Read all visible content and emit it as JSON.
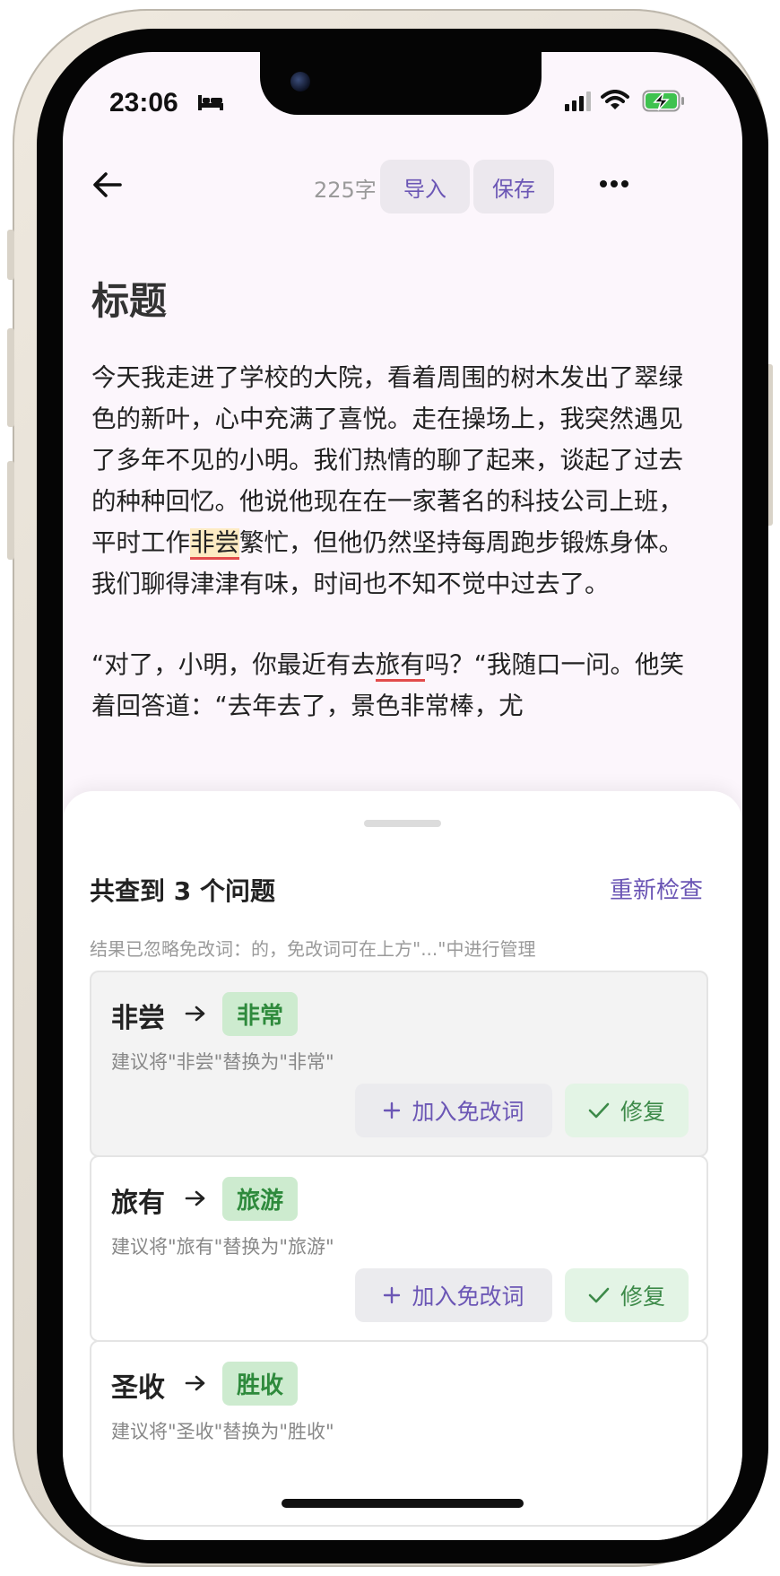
{
  "status_bar": {
    "time": "23:06"
  },
  "toolbar": {
    "word_count": "225字",
    "import_label": "导入",
    "save_label": "保存"
  },
  "document": {
    "title": "标题",
    "p1_before": "今天我走进了学校的大院，看着周围的树木发出了翠绿色的新叶，心中充满了喜悦。走在操场上，我突然遇见了多年不见的小明。我们热情的聊了起来，谈起了过去的种种回忆。他说他现在在一家著名的科技公司上班，平时工作",
    "p1_error": "非尝",
    "p1_after": "繁忙，但他仍然坚持每周跑步锻炼身体。我们聊得津津有味，时间也不知不觉中过去了。",
    "p2_before": "“对了，小明，你最近有去",
    "p2_error": "旅有",
    "p2_after": "吗？“我随口一问。他笑着回答道：“去年去了，景色非常棒，尤"
  },
  "check_panel": {
    "title": "共查到 3 个问题",
    "recheck_label": "重新检查",
    "note": "结果已忽略免改词：的，免改词可在上方\"...\"中进行管理",
    "issues": [
      {
        "wrong": "非尝",
        "correct": "非常",
        "suggestion": "建议将\"非尝\"替换为\"非常\"",
        "add_label": "加入免改词",
        "fix_label": "修复"
      },
      {
        "wrong": "旅有",
        "correct": "旅游",
        "suggestion": "建议将\"旅有\"替换为\"旅游\"",
        "add_label": "加入免改词",
        "fix_label": "修复"
      },
      {
        "wrong": "圣收",
        "correct": "胜收",
        "suggestion": "建议将\"圣收\"替换为\"胜收\""
      }
    ]
  },
  "colors": {
    "accent": "#6b56b5",
    "error_underline": "#e24b4b",
    "correct_green": "#2e8a3c",
    "screen_bg": "#fcf6fc"
  },
  "icons": [
    "bed-icon",
    "signal-icon",
    "wifi-icon",
    "battery-charging-icon",
    "back-arrow-icon",
    "more-icon",
    "right-arrow-icon",
    "plus-icon",
    "check-icon"
  ]
}
